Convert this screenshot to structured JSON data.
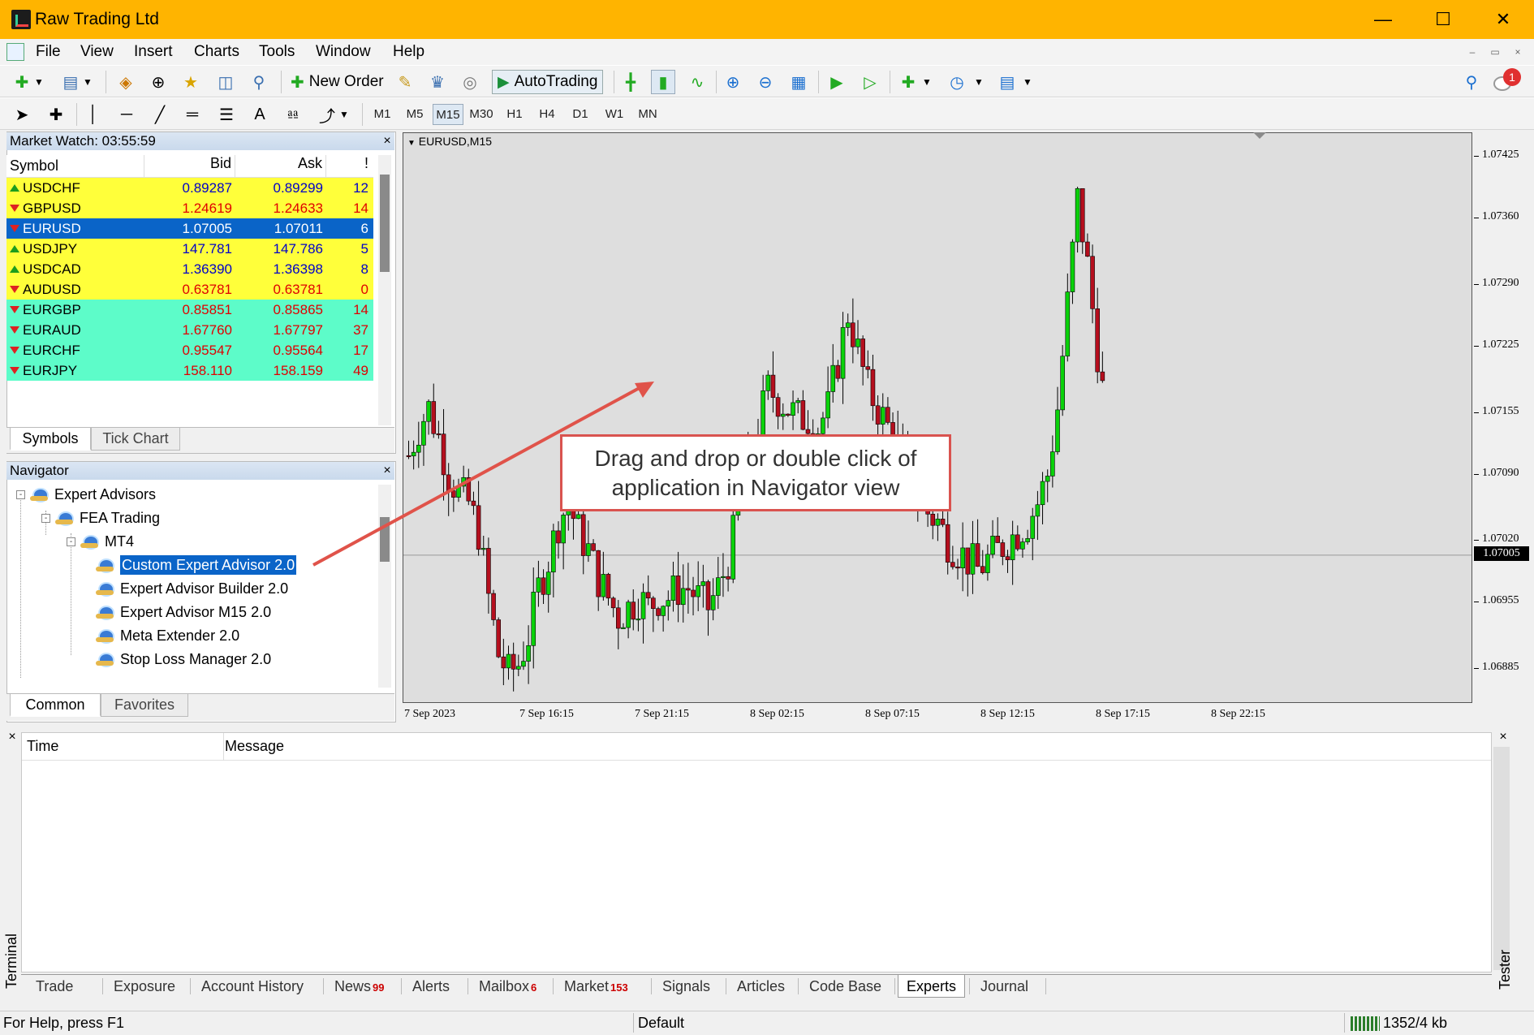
{
  "window": {
    "title": "Raw Trading Ltd"
  },
  "menu": [
    "File",
    "View",
    "Insert",
    "Charts",
    "Tools",
    "Window",
    "Help"
  ],
  "toolbar": {
    "new_order": "New Order",
    "autotrading": "AutoTrading",
    "notification_count": "1"
  },
  "timeframes": [
    "M1",
    "M5",
    "M15",
    "M30",
    "H1",
    "H4",
    "D1",
    "W1",
    "MN"
  ],
  "active_timeframe": "M15",
  "market_watch": {
    "title": "Market Watch: 03:55:59",
    "columns": [
      "Symbol",
      "Bid",
      "Ask",
      "!"
    ],
    "rows": [
      {
        "symbol": "USDCHF",
        "bid": "0.89287",
        "ask": "0.89299",
        "spread": "12",
        "dir": "up",
        "color": "blue",
        "bg": "yellow"
      },
      {
        "symbol": "GBPUSD",
        "bid": "1.24619",
        "ask": "1.24633",
        "spread": "14",
        "dir": "down",
        "color": "red",
        "bg": "yellow"
      },
      {
        "symbol": "EURUSD",
        "bid": "1.07005",
        "ask": "1.07011",
        "spread": "6",
        "dir": "down",
        "color": "white",
        "bg": "selected"
      },
      {
        "symbol": "USDJPY",
        "bid": "147.781",
        "ask": "147.786",
        "spread": "5",
        "dir": "up",
        "color": "blue",
        "bg": "yellow"
      },
      {
        "symbol": "USDCAD",
        "bid": "1.36390",
        "ask": "1.36398",
        "spread": "8",
        "dir": "up",
        "color": "blue",
        "bg": "yellow"
      },
      {
        "symbol": "AUDUSD",
        "bid": "0.63781",
        "ask": "0.63781",
        "spread": "0",
        "dir": "down",
        "color": "red",
        "bg": "yellow"
      },
      {
        "symbol": "EURGBP",
        "bid": "0.85851",
        "ask": "0.85865",
        "spread": "14",
        "dir": "down",
        "color": "red",
        "bg": "aqua"
      },
      {
        "symbol": "EURAUD",
        "bid": "1.67760",
        "ask": "1.67797",
        "spread": "37",
        "dir": "down",
        "color": "red",
        "bg": "aqua"
      },
      {
        "symbol": "EURCHF",
        "bid": "0.95547",
        "ask": "0.95564",
        "spread": "17",
        "dir": "down",
        "color": "red",
        "bg": "aqua"
      },
      {
        "symbol": "EURJPY",
        "bid": "158.110",
        "ask": "158.159",
        "spread": "49",
        "dir": "down",
        "color": "red",
        "bg": "aqua"
      }
    ],
    "tabs": [
      "Symbols",
      "Tick Chart"
    ]
  },
  "navigator": {
    "title": "Navigator",
    "tree": [
      {
        "label": "Expert Advisors",
        "level": 0,
        "toggle": "-"
      },
      {
        "label": "FEA Trading",
        "level": 1,
        "toggle": "-"
      },
      {
        "label": "MT4",
        "level": 2,
        "toggle": "-"
      },
      {
        "label": "Custom Expert Advisor 2.0",
        "level": 3,
        "selected": true
      },
      {
        "label": "Expert Advisor Builder 2.0",
        "level": 3
      },
      {
        "label": "Expert Advisor M15 2.0",
        "level": 3
      },
      {
        "label": "Meta Extender 2.0",
        "level": 3
      },
      {
        "label": "Stop Loss Manager 2.0",
        "level": 3
      }
    ],
    "tabs": [
      "Common",
      "Favorites"
    ]
  },
  "chart": {
    "symbol_label": "EURUSD,M15",
    "current_price": "1.07005",
    "callout": "Drag and drop or double click of application in Navigator view"
  },
  "chart_data": {
    "type": "candlestick",
    "title": "EURUSD,M15",
    "y_ticks": [
      "1.07425",
      "1.07360",
      "1.07290",
      "1.07225",
      "1.07155",
      "1.07090",
      "1.07020",
      "1.06955",
      "1.06885"
    ],
    "x_ticks": [
      "7 Sep 2023",
      "7 Sep 16:15",
      "7 Sep 21:15",
      "8 Sep 02:15",
      "8 Sep 07:15",
      "8 Sep 12:15",
      "8 Sep 17:15",
      "8 Sep 22:15"
    ],
    "ylim": [
      1.0685,
      1.0745
    ],
    "last_price": 1.07005,
    "close_path": [
      1.0711,
      1.0714,
      1.0716,
      1.0713,
      1.0709,
      1.0707,
      1.0706,
      1.0703,
      1.0696,
      1.069,
      1.0688,
      1.0689,
      1.0692,
      1.0697,
      1.07,
      1.0704,
      1.0706,
      1.0703,
      1.0701,
      1.0698,
      1.0696,
      1.0694,
      1.0695,
      1.0696,
      1.0695,
      1.0696,
      1.0696,
      1.0697,
      1.0697,
      1.0696,
      1.0695,
      1.0697,
      1.07,
      1.0705,
      1.071,
      1.0714,
      1.0718,
      1.0717,
      1.0716,
      1.0715,
      1.0715,
      1.0714,
      1.0716,
      1.0721,
      1.0726,
      1.0722,
      1.0718,
      1.0716,
      1.0714,
      1.0712,
      1.071,
      1.0707,
      1.0705,
      1.0704,
      1.0702,
      1.0701,
      1.07,
      1.0699,
      1.07,
      1.0701,
      1.0702,
      1.0703,
      1.0704,
      1.0706,
      1.0709,
      1.0716,
      1.0727,
      1.0738,
      1.0731,
      1.0722,
      1.0714,
      1.071,
      1.0709,
      1.0708,
      1.0707,
      1.0706,
      1.0705,
      1.0703,
      1.0702,
      1.0701,
      1.07,
      1.0699,
      1.0699,
      1.07,
      1.0701
    ]
  },
  "terminal": {
    "columns": [
      "Time",
      "Message"
    ],
    "side_label": "Terminal",
    "right_label": "Tester",
    "tabs": [
      {
        "label": "Trade"
      },
      {
        "label": "Exposure"
      },
      {
        "label": "Account History"
      },
      {
        "label": "News",
        "badge": "99"
      },
      {
        "label": "Alerts"
      },
      {
        "label": "Mailbox",
        "badge": "6"
      },
      {
        "label": "Market",
        "badge": "153"
      },
      {
        "label": "Signals"
      },
      {
        "label": "Articles"
      },
      {
        "label": "Code Base"
      },
      {
        "label": "Experts",
        "active": true
      },
      {
        "label": "Journal"
      }
    ]
  },
  "status": {
    "help": "For Help, press F1",
    "profile": "Default",
    "traffic": "1352/4 kb"
  }
}
